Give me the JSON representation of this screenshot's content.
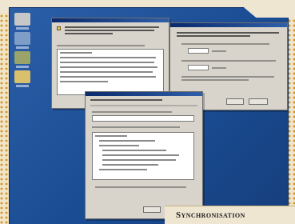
{
  "caption": {
    "text": "Synchronisation"
  },
  "desktop": {
    "icons": [
      {
        "name": "my-computer-icon"
      },
      {
        "name": "network-icon"
      },
      {
        "name": "recycle-bin-icon"
      },
      {
        "name": "folder-icon"
      }
    ]
  }
}
